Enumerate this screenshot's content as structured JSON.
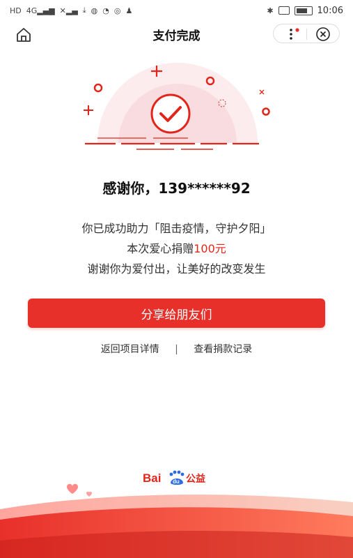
{
  "status_bar": {
    "left_icons": [
      "hd-icon",
      "signal-4g-icon",
      "signal-x-icon",
      "download-icon",
      "pay-icon",
      "wechat-icon",
      "location-icon",
      "qq-icon"
    ],
    "right_icons": [
      "bluetooth-icon",
      "vibrate-icon",
      "battery-icon"
    ],
    "time": "10:06"
  },
  "nav": {
    "title": "支付完成"
  },
  "result": {
    "thanks": "感谢你，139******92",
    "line1": "你已成功助力「阻击疫情，守护夕阳」",
    "line2_prefix": "本次爱心捐赠",
    "line2_amount": "100元",
    "line3": "谢谢你为爱付出，让美好的改变发生"
  },
  "actions": {
    "share": "分享给朋友们",
    "back_to_project": "返回项目详情",
    "separator": "|",
    "view_records": "查看捐款记录"
  },
  "brand": {
    "logo_text": "Bai du 公益",
    "accent": "#e8302a"
  }
}
